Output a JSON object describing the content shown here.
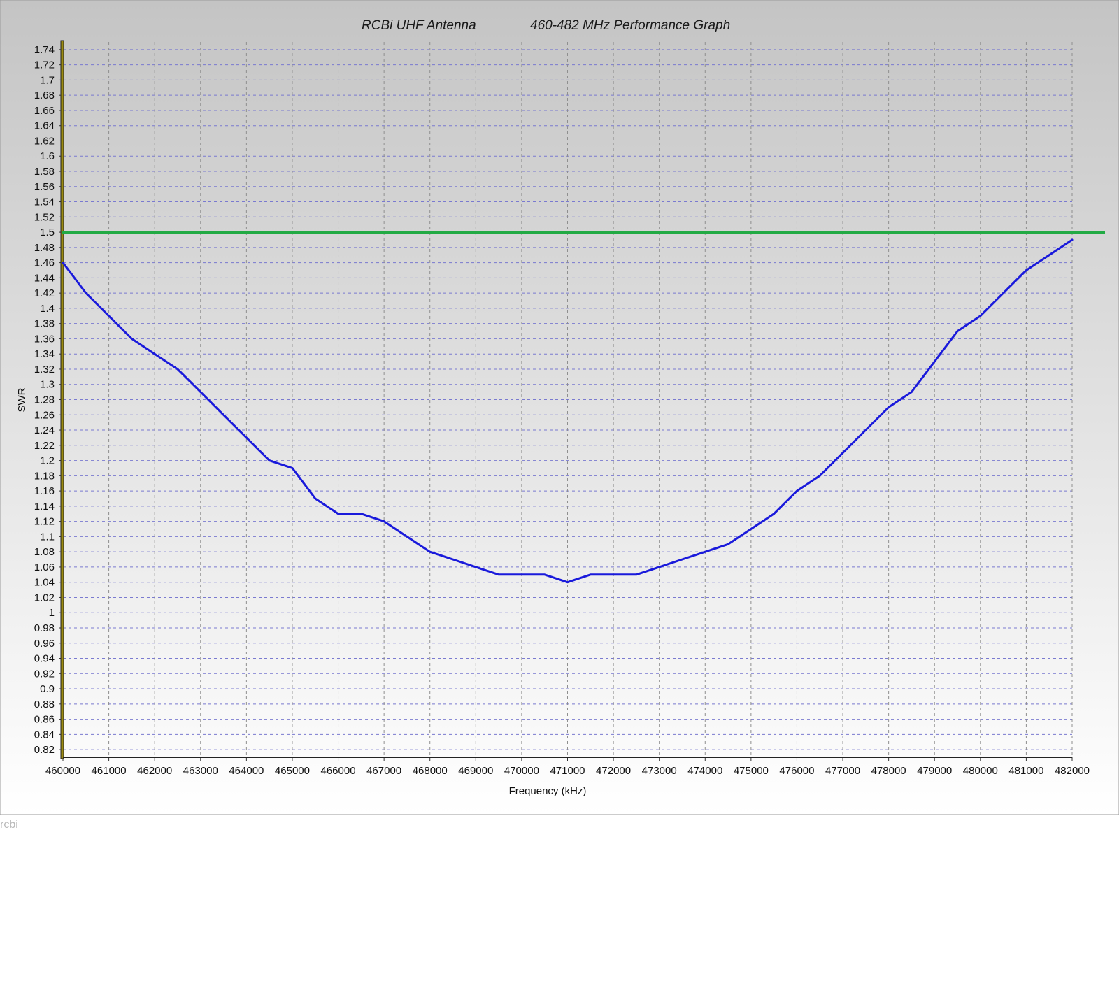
{
  "chart_data": {
    "type": "line",
    "title_left": "RCBi UHF Antenna",
    "title_right": "460-482 MHz Performance Graph",
    "xlabel": "Frequency (kHz)",
    "ylabel": "SWR",
    "xlim": [
      460000,
      482000
    ],
    "ylim": [
      0.81,
      1.75
    ],
    "x_ticks": [
      460000,
      461000,
      462000,
      463000,
      464000,
      465000,
      466000,
      467000,
      468000,
      469000,
      470000,
      471000,
      472000,
      473000,
      474000,
      475000,
      476000,
      477000,
      478000,
      479000,
      480000,
      481000,
      482000
    ],
    "y_ticks": [
      "1.74",
      "1.72",
      "1.7",
      "1.68",
      "1.66",
      "1.64",
      "1.62",
      "1.6",
      "1.58",
      "1.56",
      "1.54",
      "1.52",
      "1.5",
      "1.48",
      "1.46",
      "1.44",
      "1.42",
      "1.4",
      "1.38",
      "1.36",
      "1.34",
      "1.32",
      "1.3",
      "1.28",
      "1.26",
      "1.24",
      "1.22",
      "1.2",
      "1.18",
      "1.16",
      "1.14",
      "1.12",
      "1.1",
      "1.08",
      "1.06",
      "1.04",
      "1.02",
      "1",
      "0.98",
      "0.96",
      "0.94",
      "0.92",
      "0.9",
      "0.88",
      "0.86",
      "0.84",
      "0.82"
    ],
    "grid": true,
    "reference_line": {
      "y": 1.5,
      "color": "#22aa44"
    },
    "series": [
      {
        "color": "#1a1adb",
        "x": [
          460000,
          460500,
          461000,
          461500,
          462000,
          462500,
          463000,
          463500,
          464000,
          464500,
          465000,
          465500,
          466000,
          466500,
          467000,
          467500,
          468000,
          468500,
          469000,
          469500,
          470000,
          470500,
          471000,
          471500,
          472000,
          472500,
          473000,
          473500,
          474000,
          474500,
          475000,
          475500,
          476000,
          476500,
          477000,
          477500,
          478000,
          478500,
          479000,
          479500,
          480000,
          480500,
          481000,
          481500,
          482000
        ],
        "y": [
          1.46,
          1.42,
          1.39,
          1.36,
          1.34,
          1.32,
          1.29,
          1.26,
          1.23,
          1.2,
          1.19,
          1.15,
          1.13,
          1.13,
          1.12,
          1.1,
          1.08,
          1.07,
          1.06,
          1.05,
          1.05,
          1.05,
          1.04,
          1.05,
          1.05,
          1.05,
          1.06,
          1.07,
          1.08,
          1.09,
          1.11,
          1.13,
          1.16,
          1.18,
          1.21,
          1.24,
          1.27,
          1.29,
          1.33,
          1.37,
          1.39,
          1.42,
          1.45,
          1.47,
          1.49
        ]
      }
    ]
  },
  "watermark": "rcbi",
  "colors": {
    "background_top": "#c4c4c4",
    "background_bottom": "#ffffff",
    "grid_color": "#8f8f8f",
    "grid_color_h": "#7a7ad0",
    "y_axis_color": "#9a8a10"
  }
}
